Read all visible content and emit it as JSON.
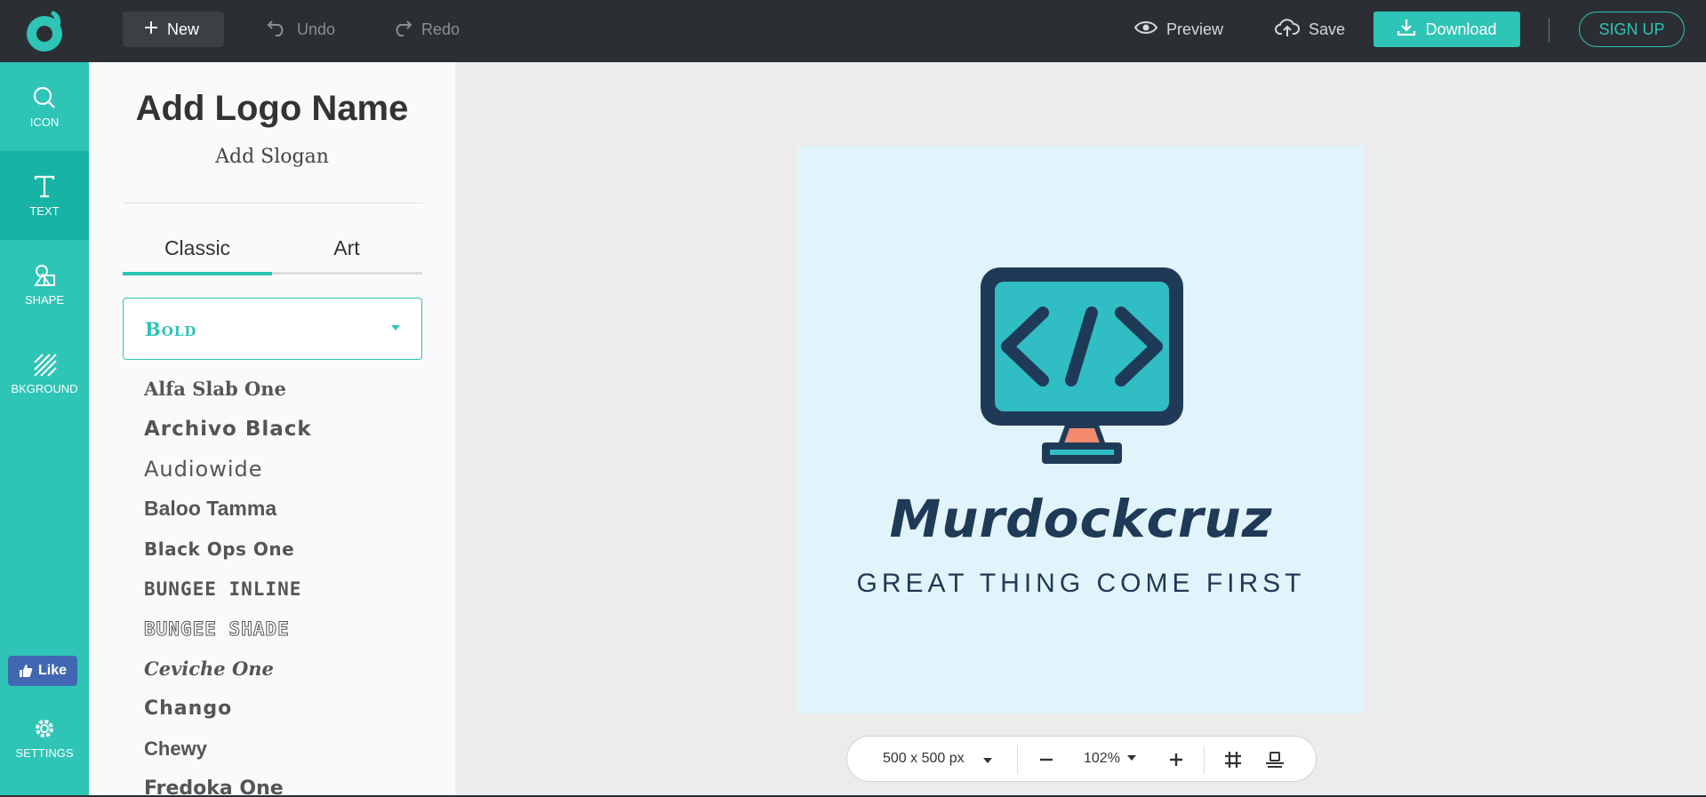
{
  "toolbar": {
    "new_label": "New",
    "undo_label": "Undo",
    "redo_label": "Redo",
    "preview_label": "Preview",
    "save_label": "Save",
    "download_label": "Download",
    "signup_label": "SIGN UP"
  },
  "sidebar": {
    "items": [
      {
        "label": "ICON",
        "icon": "search-icon"
      },
      {
        "label": "TEXT",
        "icon": "text-icon"
      },
      {
        "label": "SHAPE",
        "icon": "shape-icon"
      },
      {
        "label": "BKGROUND",
        "icon": "background-icon"
      },
      {
        "label": "SETTINGS",
        "icon": "gear-icon"
      }
    ],
    "like_label": "Like"
  },
  "panel": {
    "logo_name": "Add Logo Name",
    "slogan": "Add Slogan",
    "tabs": [
      {
        "label": "Classic"
      },
      {
        "label": "Art"
      }
    ],
    "category": "Bold",
    "fonts": [
      "Alfa Slab One",
      "Archivo Black",
      "Audiowide",
      "Baloo Tamma",
      "Black Ops One",
      "BUNGEE INLINE",
      "BUNGEE SHADE",
      "Ceviche One",
      "Chango",
      "Chewy",
      "Fredoka One"
    ]
  },
  "canvas": {
    "brand_name": "Murdockcruz",
    "tagline": "GREAT THING COME FIRST",
    "colors": {
      "background": "#e2f4fb",
      "dark": "#1f3a56",
      "screen": "#2ec4c6",
      "stand": "#f28b6e"
    }
  },
  "bottombar": {
    "size_label": "500 x 500 px",
    "zoom_label": "102%"
  },
  "colors": {
    "accent": "#2ec4b6",
    "topbar": "#2b2f33",
    "facebook": "#4267b2"
  }
}
